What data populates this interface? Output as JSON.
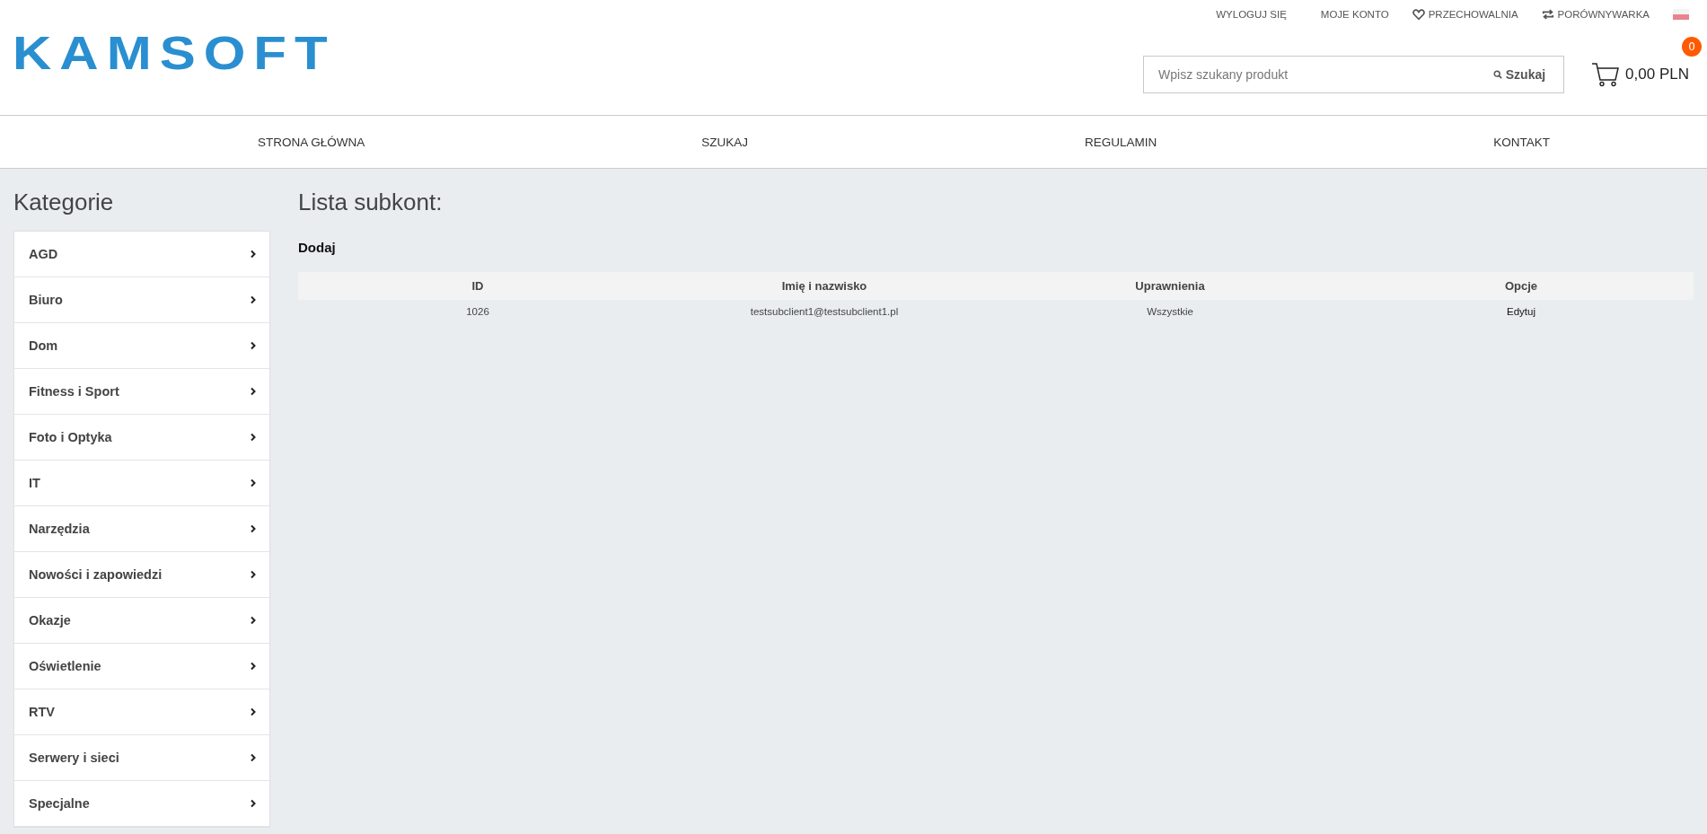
{
  "logo": "KAMSOFT",
  "top_links": [
    {
      "label": "WYLOGUJ SIĘ",
      "kind": "plain"
    },
    {
      "label": "MOJE KONTO",
      "kind": "plain"
    },
    {
      "label": "PRZECHOWALNIA",
      "kind": "wishlist"
    },
    {
      "label": "PORÓWNYWARKA",
      "kind": "compare"
    }
  ],
  "search": {
    "placeholder": "Wpisz szukany produkt",
    "button": "Szukaj"
  },
  "cart": {
    "total": "0,00 PLN",
    "count": "0"
  },
  "nav": [
    "STRONA GŁÓWNA",
    "SZUKAJ",
    "REGULAMIN",
    "KONTAKT"
  ],
  "sidebar": {
    "title": "Kategorie",
    "items": [
      "AGD",
      "Biuro",
      "Dom",
      "Fitness i Sport",
      "Foto i Optyka",
      "IT",
      "Narzędzia",
      "Nowości i zapowiedzi",
      "Okazje",
      "Oświetlenie",
      "RTV",
      "Serwery i sieci",
      "Specjalne"
    ]
  },
  "content": {
    "title": "Lista subkont:",
    "add_link": "Dodaj",
    "table": {
      "columns": [
        "ID",
        "Imię i nazwisko",
        "Uprawnienia",
        "Opcje"
      ],
      "rows": [
        {
          "id": "1026",
          "name": "testsubclient1@testsubclient1.pl",
          "permissions": "Wszystkie",
          "option": "Edytuj"
        }
      ]
    }
  }
}
